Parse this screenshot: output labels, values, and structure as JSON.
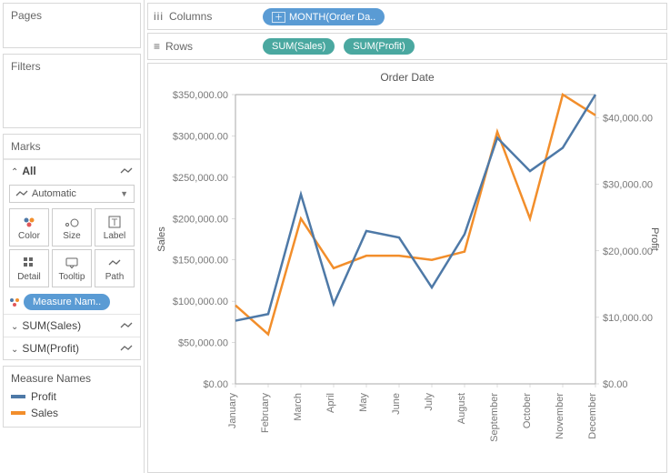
{
  "shelves": {
    "pages": "Pages",
    "filters": "Filters",
    "marks": "Marks",
    "all": "All",
    "automatic": "Automatic",
    "columns": "Columns",
    "rows": "Rows"
  },
  "mark_buttons": {
    "color": "Color",
    "size": "Size",
    "label": "Label",
    "detail": "Detail",
    "tooltip": "Tooltip",
    "path": "Path"
  },
  "mark_color_pill": "Measure Nam..",
  "mark_measures": {
    "sales": "SUM(Sales)",
    "profit": "SUM(Profit)"
  },
  "columns_pill": "MONTH(Order Da..",
  "rows_pills": {
    "sales": "SUM(Sales)",
    "profit": "SUM(Profit)"
  },
  "legend": {
    "title": "Measure Names",
    "items": [
      {
        "label": "Profit",
        "color": "#4e79a7"
      },
      {
        "label": "Sales",
        "color": "#f28e2b"
      }
    ]
  },
  "chart_title": "Order Date",
  "axis_left_label": "Sales",
  "axis_right_label": "Profit",
  "chart_data": {
    "type": "line",
    "title": "Order Date",
    "xlabel": "Order Date (Month)",
    "categories": [
      "January",
      "February",
      "March",
      "April",
      "May",
      "June",
      "July",
      "August",
      "September",
      "October",
      "November",
      "December"
    ],
    "series": [
      {
        "name": "Sales",
        "axis": "left",
        "color": "#f28e2b",
        "values": [
          95000,
          60000,
          200000,
          140000,
          155000,
          155000,
          150000,
          160000,
          305000,
          200000,
          350000,
          325000
        ],
        "ylabel": "Sales",
        "ylim": [
          0,
          350000
        ],
        "ytick_labels": [
          "$0.00",
          "$50,000.00",
          "$100,000.00",
          "$150,000.00",
          "$200,000.00",
          "$250,000.00",
          "$300,000.00",
          "$350,000.00"
        ],
        "ytick_values": [
          0,
          50000,
          100000,
          150000,
          200000,
          250000,
          300000,
          350000
        ]
      },
      {
        "name": "Profit",
        "axis": "right",
        "color": "#4e79a7",
        "values": [
          9500,
          10500,
          28500,
          12000,
          23000,
          22000,
          14500,
          22500,
          37000,
          32000,
          35500,
          43500
        ],
        "ylabel": "Profit",
        "ylim": [
          0,
          43500
        ],
        "ytick_labels": [
          "$0.00",
          "$10,000.00",
          "$20,000.00",
          "$30,000.00",
          "$40,000.00"
        ],
        "ytick_values": [
          0,
          10000,
          20000,
          30000,
          40000
        ]
      }
    ]
  }
}
